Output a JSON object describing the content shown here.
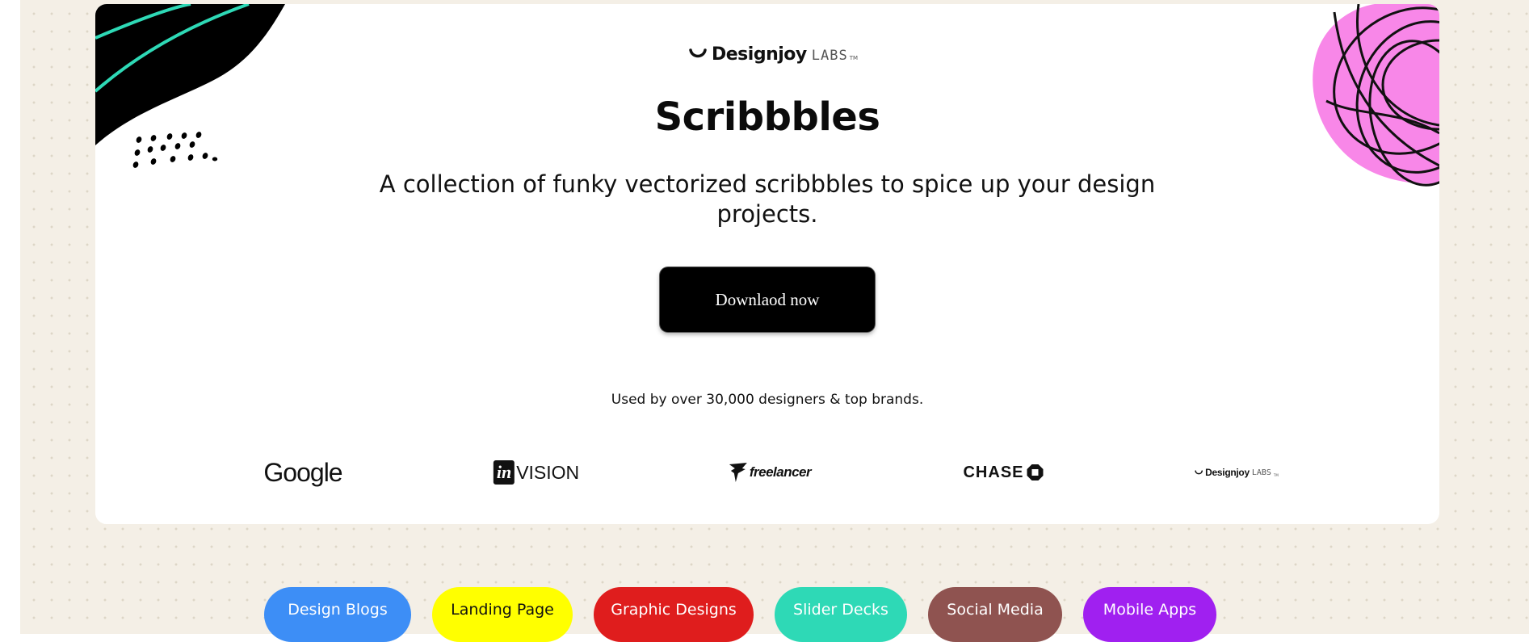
{
  "hero": {
    "brand": {
      "name": "Designjoy",
      "labs": "LABS",
      "tm": "TM"
    },
    "title": "Scribbbles",
    "tagline": "A collection of funky vectorized scribbbles to spice up your design projects.",
    "cta_label": "Downlaod now",
    "social_proof": "Used by over 30,000 designers & top brands."
  },
  "brands": {
    "google": "Google",
    "invision_badge": "in",
    "invision_word": "VISION",
    "freelancer": "freelancer",
    "chase": "CHASE",
    "designjoy_name": "Designjoy",
    "designjoy_labs": "LABS",
    "designjoy_tm": "TM"
  },
  "categories": [
    {
      "label": "Design  Blogs",
      "color": "#3d8ef6",
      "text_color": "#ffffff"
    },
    {
      "label": "Landing Page",
      "color": "#ffff00",
      "text_color": "#111111"
    },
    {
      "label": "Graphic Designs",
      "color": "#df1d1d",
      "text_color": "#ffffff"
    },
    {
      "label": "Slider Decks",
      "color": "#2ed9b6",
      "text_color": "#ffffff"
    },
    {
      "label": "Social Media",
      "color": "#8f5350",
      "text_color": "#ffffff"
    },
    {
      "label": "Mobile Apps",
      "color": "#a020f0",
      "text_color": "#ffffff"
    }
  ],
  "theme": {
    "page_background": "#f4efe6",
    "card_background": "#ffffff",
    "accent_teal": "#2ed9b6",
    "accent_pink": "#f887e8",
    "button_background": "#000000"
  },
  "icons": {
    "brand_mark": "smile-arc-icon",
    "freelancer_mark": "bird-icon",
    "chase_mark": "octagon-icon",
    "left_decoration": "black-blob-with-teal-stripes",
    "right_decoration": "pink-blob-with-scribble"
  }
}
